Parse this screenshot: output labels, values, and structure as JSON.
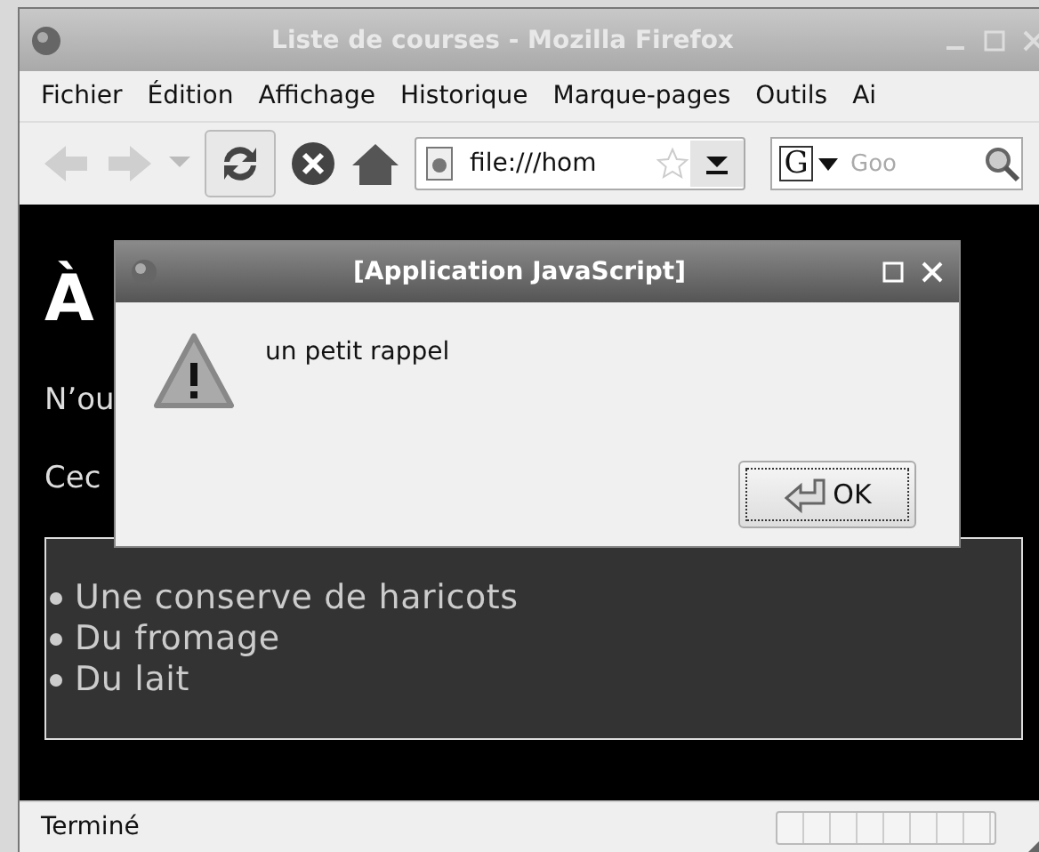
{
  "window": {
    "title": "Liste de courses - Mozilla Firefox"
  },
  "menu": [
    "Fichier",
    "Édition",
    "Affichage",
    "Historique",
    "Marque-pages",
    "Outils",
    "Ai"
  ],
  "toolbar": {
    "back_disabled": true,
    "forward_disabled": true,
    "url": "file:///hom",
    "search_engine": "G",
    "search_placeholder": "Goo"
  },
  "page": {
    "heading": "À",
    "paragraphs": [
      "N’ou",
      "Cec"
    ],
    "list": [
      "Une conserve de haricots",
      "Du fromage",
      "Du lait"
    ]
  },
  "dialog": {
    "title": "[Application JavaScript]",
    "message": "un petit rappel",
    "button": "OK"
  },
  "status_bar": {
    "text": "Terminé",
    "level": 0
  }
}
